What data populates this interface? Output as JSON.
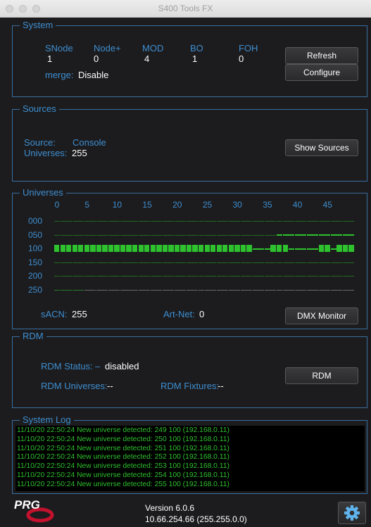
{
  "window": {
    "title": "S400 Tools FX"
  },
  "system": {
    "title": "System",
    "stats": [
      {
        "label": "SNode",
        "value": "1"
      },
      {
        "label": "Node+",
        "value": "0"
      },
      {
        "label": "MOD",
        "value": "4"
      },
      {
        "label": "BO",
        "value": "1"
      },
      {
        "label": "FOH",
        "value": "0"
      }
    ],
    "merge_label": "merge:",
    "merge_value": "Disable",
    "refresh_label": "Refresh",
    "configure_label": "Configure"
  },
  "sources": {
    "title": "Sources",
    "source_label": "Source:",
    "source_value": "Console",
    "universes_label": "Universes:",
    "universes_value": "255",
    "show_sources_label": "Show Sources"
  },
  "universes": {
    "title": "Universes",
    "col_ticks": [
      "0",
      "5",
      "10",
      "15",
      "20",
      "25",
      "30",
      "35",
      "40",
      "45"
    ],
    "row_labels": [
      "000",
      "050",
      "100",
      "150",
      "200",
      "250"
    ],
    "sacn_label": "sACN:",
    "sacn_value": "255",
    "artnet_label": "Art-Net:",
    "artnet_value": "0",
    "dmx_monitor_label": "DMX Monitor",
    "colors": {
      "active": "#2ec22e",
      "idle": "#1f6a1f",
      "none": "#6a6a6a"
    }
  },
  "rdm": {
    "title": "RDM",
    "status_label": "RDM Status:",
    "status_dash": "–",
    "status_value": "disabled",
    "universes_label": "RDM Universes:",
    "universes_value": "--",
    "fixtures_label": "RDM Fixtures:",
    "fixtures_value": "--",
    "rdm_button_label": "RDM"
  },
  "system_log": {
    "title": "System Log",
    "lines": [
      "11/10/20 22:50:24  New universe detected: 249   100 (192.168.0.11)",
      "11/10/20 22:50:24  New universe detected: 250   100 (192.168.0.11)",
      "11/10/20 22:50:24  New universe detected: 251   100 (192.168.0.11)",
      "11/10/20 22:50:24  New universe detected: 252   100 (192.168.0.11)",
      "11/10/20 22:50:24  New universe detected: 253   100 (192.168.0.11)",
      "11/10/20 22:50:24  New universe detected: 254   100 (192.168.0.11)",
      "11/10/20 22:50:24  New universe detected: 255   100 (192.168.0.11)"
    ]
  },
  "footer": {
    "logo_text": "PRG",
    "version": "Version 6.0.6",
    "address": "10.66.254.66 (255.255.0.0)",
    "settings_icon": "gear-icon"
  }
}
